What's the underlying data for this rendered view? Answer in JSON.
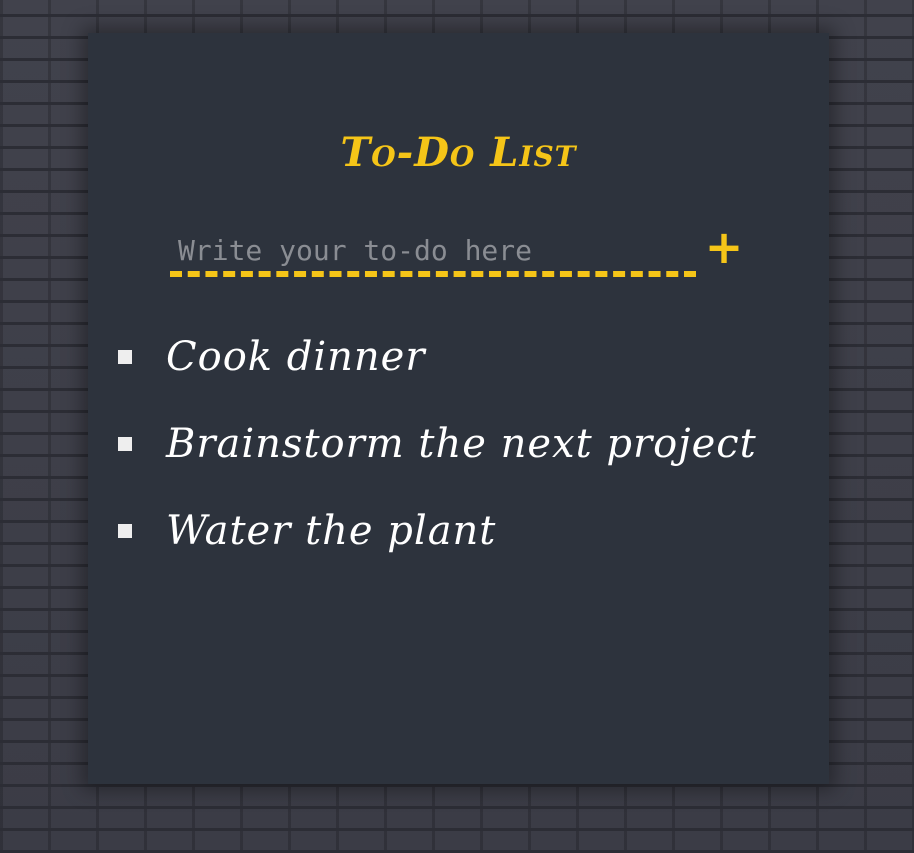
{
  "title": "To-Do List",
  "input": {
    "placeholder": "Write your to-do here",
    "value": ""
  },
  "add_button": {
    "label": "+"
  },
  "todos": [
    {
      "text": "Cook dinner"
    },
    {
      "text": "Brainstorm the next project"
    },
    {
      "text": "Water the plant"
    }
  ],
  "colors": {
    "accent": "#f5c518",
    "board_background": "#2d333d",
    "wall_background": "#3a3b45",
    "text": "#ffffff",
    "placeholder": "#8a8d93"
  }
}
